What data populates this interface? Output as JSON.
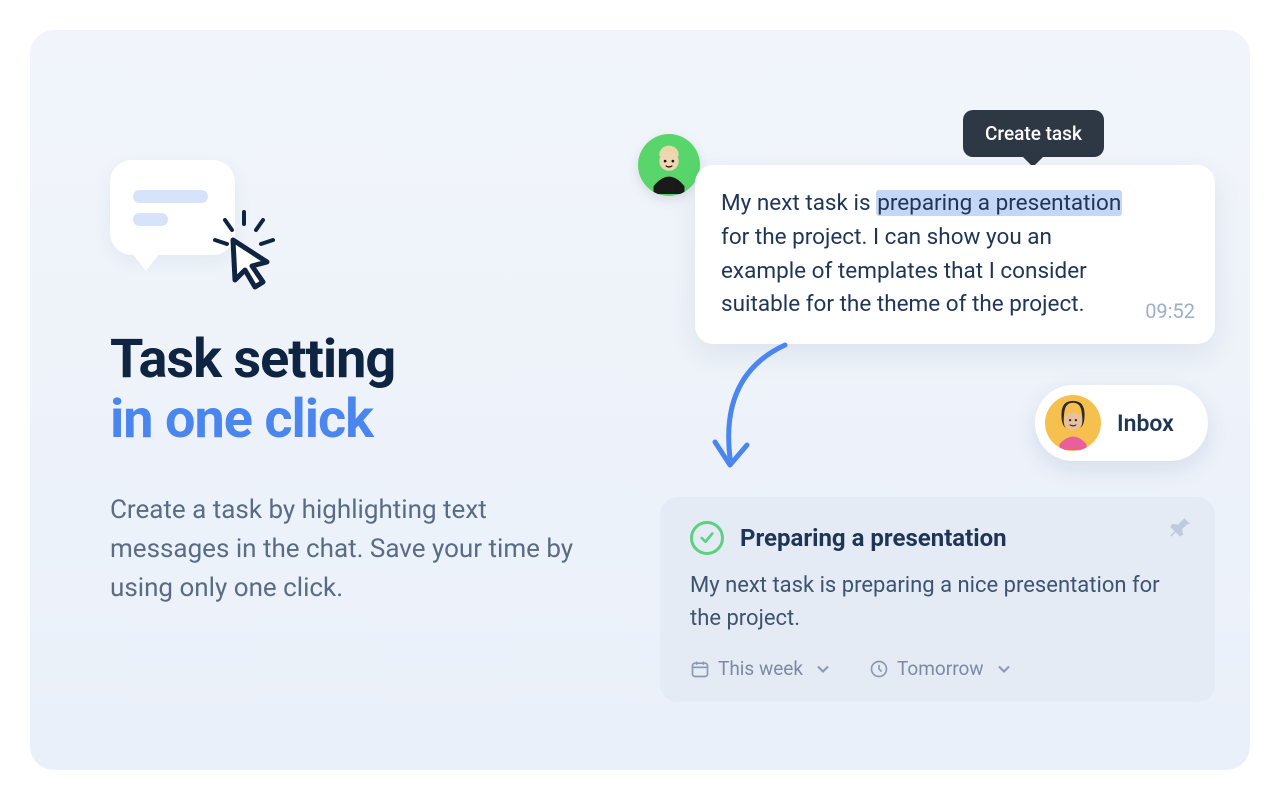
{
  "heading": {
    "line1": "Task setting",
    "line2": "in one click"
  },
  "subheading": "Create a task by highlighting text messages in the chat. Save your time by using only one click.",
  "tooltip": {
    "label": "Create task"
  },
  "message": {
    "text_before": "My next task is ",
    "highlighted": "preparing a presentation",
    "text_after": " for the project. I can show you an example of templates that I consider suitable for the theme of the project.",
    "time": "09:52"
  },
  "inbox": {
    "label": "Inbox"
  },
  "task": {
    "title": "Preparing a presentation",
    "body": "My next task is preparing a nice presentation for the project.",
    "date_range": "This week",
    "due": "Tomorrow"
  },
  "icons": {
    "sender_avatar": "person-avatar-green",
    "assignee_avatar": "person-avatar-yellow",
    "check": "check-circle",
    "pin": "pin",
    "calendar": "calendar",
    "clock": "clock",
    "chevron": "chevron-down",
    "cursor": "cursor-click",
    "arrow": "curved-arrow"
  }
}
